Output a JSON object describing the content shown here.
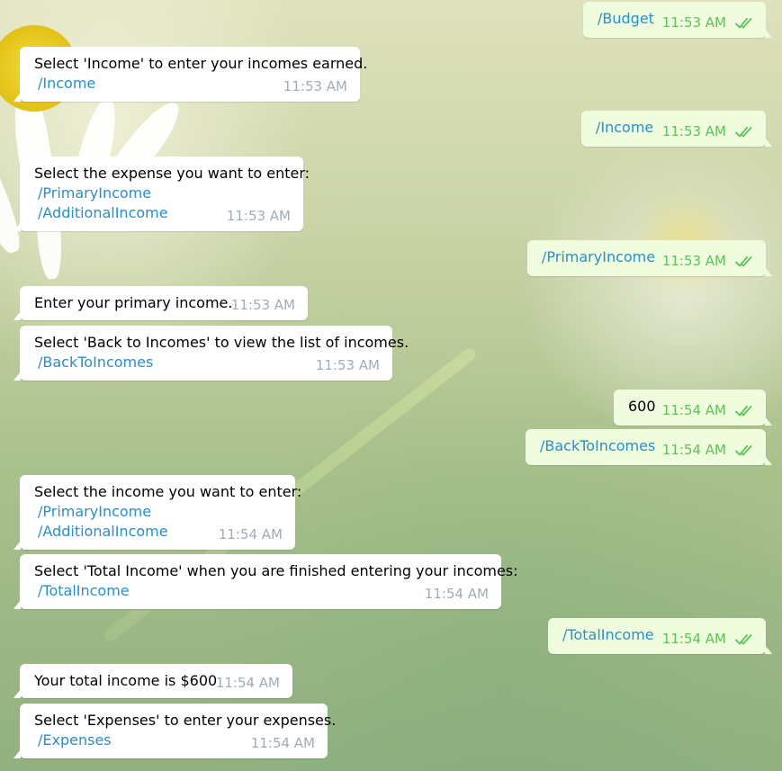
{
  "messages": [
    {
      "id": "m1",
      "direction": "out",
      "lines": [
        {
          "text": "/Budget",
          "type": "command"
        }
      ],
      "time": "11:53 AM",
      "read": true
    },
    {
      "id": "m2",
      "direction": "in",
      "lines": [
        {
          "text": "Select 'Income' to enter your incomes earned.",
          "type": "text"
        },
        {
          "text": "/Income",
          "type": "command"
        }
      ],
      "time": "11:53 AM"
    },
    {
      "id": "m3",
      "direction": "out",
      "lines": [
        {
          "text": "/Income",
          "type": "command"
        }
      ],
      "time": "11:53 AM",
      "read": true
    },
    {
      "id": "m4",
      "direction": "in",
      "lines": [
        {
          "text": "Select the expense you want to enter:",
          "type": "text"
        },
        {
          "text": "/PrimaryIncome",
          "type": "command"
        },
        {
          "text": "/AdditionalIncome",
          "type": "command"
        }
      ],
      "time": "11:53 AM"
    },
    {
      "id": "m5",
      "direction": "out",
      "lines": [
        {
          "text": "/PrimaryIncome",
          "type": "command"
        }
      ],
      "time": "11:53 AM",
      "read": true
    },
    {
      "id": "m6",
      "direction": "in",
      "lines": [
        {
          "text": "Enter your primary income.",
          "type": "text"
        }
      ],
      "time": "11:53 AM"
    },
    {
      "id": "m7",
      "direction": "in",
      "lines": [
        {
          "text": "Select 'Back to Incomes' to view the list of incomes.",
          "type": "text"
        },
        {
          "text": "/BackToIncomes",
          "type": "command"
        }
      ],
      "time": "11:53 AM"
    },
    {
      "id": "m8",
      "direction": "out",
      "lines": [
        {
          "text": "600",
          "type": "text"
        }
      ],
      "time": "11:54 AM",
      "read": true
    },
    {
      "id": "m9",
      "direction": "out",
      "lines": [
        {
          "text": "/BackToIncomes",
          "type": "command"
        }
      ],
      "time": "11:54 AM",
      "read": true
    },
    {
      "id": "m10",
      "direction": "in",
      "lines": [
        {
          "text": "Select the income you want to enter:",
          "type": "text"
        },
        {
          "text": "/PrimaryIncome",
          "type": "command"
        },
        {
          "text": "/AdditionalIncome",
          "type": "command"
        }
      ],
      "time": "11:54 AM"
    },
    {
      "id": "m11",
      "direction": "in",
      "lines": [
        {
          "text": "Select 'Total Income' when you are finished entering your incomes:",
          "type": "text"
        },
        {
          "text": "/TotalIncome",
          "type": "command"
        }
      ],
      "time": "11:54 AM"
    },
    {
      "id": "m12",
      "direction": "out",
      "lines": [
        {
          "text": "/TotalIncome",
          "type": "command"
        }
      ],
      "time": "11:54 AM",
      "read": true
    },
    {
      "id": "m13",
      "direction": "in",
      "lines": [
        {
          "text": "Your total income is $600",
          "type": "text"
        }
      ],
      "time": "11:54 AM"
    },
    {
      "id": "m14",
      "direction": "in",
      "lines": [
        {
          "text": "Select 'Expenses' to enter your expenses.",
          "type": "text"
        },
        {
          "text": "/Expenses",
          "type": "command"
        }
      ],
      "time": "11:54 AM"
    }
  ],
  "colors": {
    "incoming_bubble": "#ffffff",
    "outgoing_bubble": "#effdde",
    "command_link": "#2a8ec7",
    "incoming_time": "#a0acb6",
    "outgoing_time": "#5ec15a",
    "read_ticks": "#5ec15a"
  },
  "icons": {
    "read_receipt": "double-check-icon"
  }
}
